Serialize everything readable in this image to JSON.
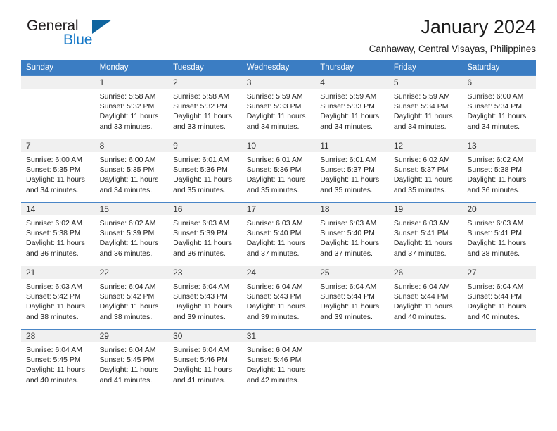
{
  "brand": {
    "word_one": "General",
    "word_two": "Blue",
    "triangle_icon": "triangle-logo-mark",
    "colors": {
      "dark": "#231f20",
      "blue": "#1377c7",
      "triangle": "#10659f"
    }
  },
  "header": {
    "title": "January 2024",
    "subtitle": "Canhaway, Central Visayas, Philippines"
  },
  "theme": {
    "header_blue": "#3b7dc3",
    "daynum_band": "#f0f0f0",
    "text": "#232323"
  },
  "weekday_headers": [
    "Sunday",
    "Monday",
    "Tuesday",
    "Wednesday",
    "Thursday",
    "Friday",
    "Saturday"
  ],
  "labels": {
    "sunrise": "Sunrise:",
    "sunset": "Sunset:",
    "daylight": "Daylight:"
  },
  "weeks": [
    [
      {
        "day": "",
        "sunrise": "",
        "sunset": "",
        "daylight_a": "",
        "daylight_b": ""
      },
      {
        "day": "1",
        "sunrise": "Sunrise: 5:58 AM",
        "sunset": "Sunset: 5:32 PM",
        "daylight_a": "Daylight: 11 hours",
        "daylight_b": "and 33 minutes."
      },
      {
        "day": "2",
        "sunrise": "Sunrise: 5:58 AM",
        "sunset": "Sunset: 5:32 PM",
        "daylight_a": "Daylight: 11 hours",
        "daylight_b": "and 33 minutes."
      },
      {
        "day": "3",
        "sunrise": "Sunrise: 5:59 AM",
        "sunset": "Sunset: 5:33 PM",
        "daylight_a": "Daylight: 11 hours",
        "daylight_b": "and 34 minutes."
      },
      {
        "day": "4",
        "sunrise": "Sunrise: 5:59 AM",
        "sunset": "Sunset: 5:33 PM",
        "daylight_a": "Daylight: 11 hours",
        "daylight_b": "and 34 minutes."
      },
      {
        "day": "5",
        "sunrise": "Sunrise: 5:59 AM",
        "sunset": "Sunset: 5:34 PM",
        "daylight_a": "Daylight: 11 hours",
        "daylight_b": "and 34 minutes."
      },
      {
        "day": "6",
        "sunrise": "Sunrise: 6:00 AM",
        "sunset": "Sunset: 5:34 PM",
        "daylight_a": "Daylight: 11 hours",
        "daylight_b": "and 34 minutes."
      }
    ],
    [
      {
        "day": "7",
        "sunrise": "Sunrise: 6:00 AM",
        "sunset": "Sunset: 5:35 PM",
        "daylight_a": "Daylight: 11 hours",
        "daylight_b": "and 34 minutes."
      },
      {
        "day": "8",
        "sunrise": "Sunrise: 6:00 AM",
        "sunset": "Sunset: 5:35 PM",
        "daylight_a": "Daylight: 11 hours",
        "daylight_b": "and 34 minutes."
      },
      {
        "day": "9",
        "sunrise": "Sunrise: 6:01 AM",
        "sunset": "Sunset: 5:36 PM",
        "daylight_a": "Daylight: 11 hours",
        "daylight_b": "and 35 minutes."
      },
      {
        "day": "10",
        "sunrise": "Sunrise: 6:01 AM",
        "sunset": "Sunset: 5:36 PM",
        "daylight_a": "Daylight: 11 hours",
        "daylight_b": "and 35 minutes."
      },
      {
        "day": "11",
        "sunrise": "Sunrise: 6:01 AM",
        "sunset": "Sunset: 5:37 PM",
        "daylight_a": "Daylight: 11 hours",
        "daylight_b": "and 35 minutes."
      },
      {
        "day": "12",
        "sunrise": "Sunrise: 6:02 AM",
        "sunset": "Sunset: 5:37 PM",
        "daylight_a": "Daylight: 11 hours",
        "daylight_b": "and 35 minutes."
      },
      {
        "day": "13",
        "sunrise": "Sunrise: 6:02 AM",
        "sunset": "Sunset: 5:38 PM",
        "daylight_a": "Daylight: 11 hours",
        "daylight_b": "and 36 minutes."
      }
    ],
    [
      {
        "day": "14",
        "sunrise": "Sunrise: 6:02 AM",
        "sunset": "Sunset: 5:38 PM",
        "daylight_a": "Daylight: 11 hours",
        "daylight_b": "and 36 minutes."
      },
      {
        "day": "15",
        "sunrise": "Sunrise: 6:02 AM",
        "sunset": "Sunset: 5:39 PM",
        "daylight_a": "Daylight: 11 hours",
        "daylight_b": "and 36 minutes."
      },
      {
        "day": "16",
        "sunrise": "Sunrise: 6:03 AM",
        "sunset": "Sunset: 5:39 PM",
        "daylight_a": "Daylight: 11 hours",
        "daylight_b": "and 36 minutes."
      },
      {
        "day": "17",
        "sunrise": "Sunrise: 6:03 AM",
        "sunset": "Sunset: 5:40 PM",
        "daylight_a": "Daylight: 11 hours",
        "daylight_b": "and 37 minutes."
      },
      {
        "day": "18",
        "sunrise": "Sunrise: 6:03 AM",
        "sunset": "Sunset: 5:40 PM",
        "daylight_a": "Daylight: 11 hours",
        "daylight_b": "and 37 minutes."
      },
      {
        "day": "19",
        "sunrise": "Sunrise: 6:03 AM",
        "sunset": "Sunset: 5:41 PM",
        "daylight_a": "Daylight: 11 hours",
        "daylight_b": "and 37 minutes."
      },
      {
        "day": "20",
        "sunrise": "Sunrise: 6:03 AM",
        "sunset": "Sunset: 5:41 PM",
        "daylight_a": "Daylight: 11 hours",
        "daylight_b": "and 38 minutes."
      }
    ],
    [
      {
        "day": "21",
        "sunrise": "Sunrise: 6:03 AM",
        "sunset": "Sunset: 5:42 PM",
        "daylight_a": "Daylight: 11 hours",
        "daylight_b": "and 38 minutes."
      },
      {
        "day": "22",
        "sunrise": "Sunrise: 6:04 AM",
        "sunset": "Sunset: 5:42 PM",
        "daylight_a": "Daylight: 11 hours",
        "daylight_b": "and 38 minutes."
      },
      {
        "day": "23",
        "sunrise": "Sunrise: 6:04 AM",
        "sunset": "Sunset: 5:43 PM",
        "daylight_a": "Daylight: 11 hours",
        "daylight_b": "and 39 minutes."
      },
      {
        "day": "24",
        "sunrise": "Sunrise: 6:04 AM",
        "sunset": "Sunset: 5:43 PM",
        "daylight_a": "Daylight: 11 hours",
        "daylight_b": "and 39 minutes."
      },
      {
        "day": "25",
        "sunrise": "Sunrise: 6:04 AM",
        "sunset": "Sunset: 5:44 PM",
        "daylight_a": "Daylight: 11 hours",
        "daylight_b": "and 39 minutes."
      },
      {
        "day": "26",
        "sunrise": "Sunrise: 6:04 AM",
        "sunset": "Sunset: 5:44 PM",
        "daylight_a": "Daylight: 11 hours",
        "daylight_b": "and 40 minutes."
      },
      {
        "day": "27",
        "sunrise": "Sunrise: 6:04 AM",
        "sunset": "Sunset: 5:44 PM",
        "daylight_a": "Daylight: 11 hours",
        "daylight_b": "and 40 minutes."
      }
    ],
    [
      {
        "day": "28",
        "sunrise": "Sunrise: 6:04 AM",
        "sunset": "Sunset: 5:45 PM",
        "daylight_a": "Daylight: 11 hours",
        "daylight_b": "and 40 minutes."
      },
      {
        "day": "29",
        "sunrise": "Sunrise: 6:04 AM",
        "sunset": "Sunset: 5:45 PM",
        "daylight_a": "Daylight: 11 hours",
        "daylight_b": "and 41 minutes."
      },
      {
        "day": "30",
        "sunrise": "Sunrise: 6:04 AM",
        "sunset": "Sunset: 5:46 PM",
        "daylight_a": "Daylight: 11 hours",
        "daylight_b": "and 41 minutes."
      },
      {
        "day": "31",
        "sunrise": "Sunrise: 6:04 AM",
        "sunset": "Sunset: 5:46 PM",
        "daylight_a": "Daylight: 11 hours",
        "daylight_b": "and 42 minutes."
      },
      {
        "day": "",
        "sunrise": "",
        "sunset": "",
        "daylight_a": "",
        "daylight_b": ""
      },
      {
        "day": "",
        "sunrise": "",
        "sunset": "",
        "daylight_a": "",
        "daylight_b": ""
      },
      {
        "day": "",
        "sunrise": "",
        "sunset": "",
        "daylight_a": "",
        "daylight_b": ""
      }
    ]
  ]
}
